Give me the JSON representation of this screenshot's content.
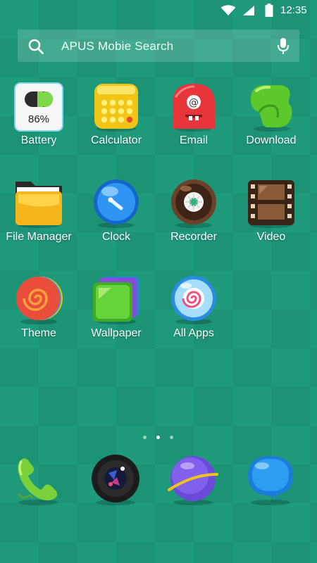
{
  "status_bar": {
    "time": "12:35",
    "icons": [
      "wifi-icon",
      "cell-signal-icon",
      "battery-icon"
    ]
  },
  "search": {
    "placeholder": "APUS Mobie Search",
    "icons": [
      "search-icon",
      "microphone-icon"
    ]
  },
  "apps": [
    {
      "label": "Battery",
      "icon": "battery-app-icon",
      "badge_text": "86%",
      "level": 0.86
    },
    {
      "label": "Calculator",
      "icon": "calculator-app-icon"
    },
    {
      "label": "Email",
      "icon": "email-app-icon"
    },
    {
      "label": "Download",
      "icon": "download-app-icon"
    },
    {
      "label": "File Manager",
      "icon": "folder-app-icon"
    },
    {
      "label": "Clock",
      "icon": "clock-app-icon"
    },
    {
      "label": "Recorder",
      "icon": "recorder-app-icon"
    },
    {
      "label": "Video",
      "icon": "video-app-icon"
    },
    {
      "label": "Theme",
      "icon": "theme-app-icon"
    },
    {
      "label": "Wallpaper",
      "icon": "wallpaper-app-icon"
    },
    {
      "label": "All Apps",
      "icon": "all-apps-icon"
    }
  ],
  "page_indicator": {
    "count": 3,
    "active": 1
  },
  "dock": [
    {
      "icon": "phone-icon"
    },
    {
      "icon": "camera-icon"
    },
    {
      "icon": "browser-icon"
    },
    {
      "icon": "messages-icon"
    }
  ],
  "colors": {
    "background": "#1f9b7b",
    "text": "#ffffff"
  }
}
